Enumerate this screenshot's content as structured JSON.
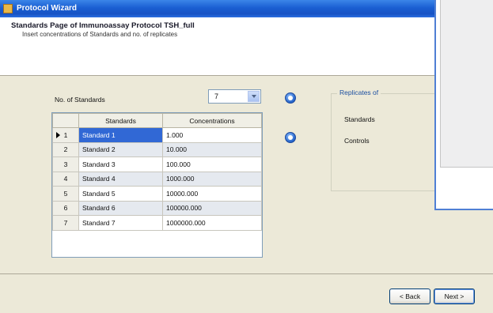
{
  "window": {
    "title": "Protocol Wizard"
  },
  "header": {
    "title": "Standards Page of Immunoassay Protocol TSH_full",
    "subtitle": "Insert concentrations of Standards and no. of replicates"
  },
  "standards_count": {
    "label": "No. of Standards",
    "value": "7"
  },
  "grid": {
    "columns": [
      "Standards",
      "Concentrations"
    ],
    "rows": [
      {
        "num": "1",
        "name": "Standard 1",
        "conc": "1.000"
      },
      {
        "num": "2",
        "name": "Standard 2",
        "conc": "10.000"
      },
      {
        "num": "3",
        "name": "Standard 3",
        "conc": "100.000"
      },
      {
        "num": "4",
        "name": "Standard 4",
        "conc": "1000.000"
      },
      {
        "num": "5",
        "name": "Standard 5",
        "conc": "10000.000"
      },
      {
        "num": "6",
        "name": "Standard 6",
        "conc": "100000.000"
      },
      {
        "num": "7",
        "name": "Standard 7",
        "conc": "1000000.000"
      }
    ],
    "selected_row": 1
  },
  "replicates": {
    "title": "Replicates of",
    "standards_label": "Standards",
    "controls_label": "Controls"
  },
  "footer": {
    "back_label": "< Back",
    "next_label": "Next >"
  },
  "colors": {
    "selection": "#3168d5",
    "titlebar": "#1a5fd2",
    "accent": "#4f7fd4"
  }
}
